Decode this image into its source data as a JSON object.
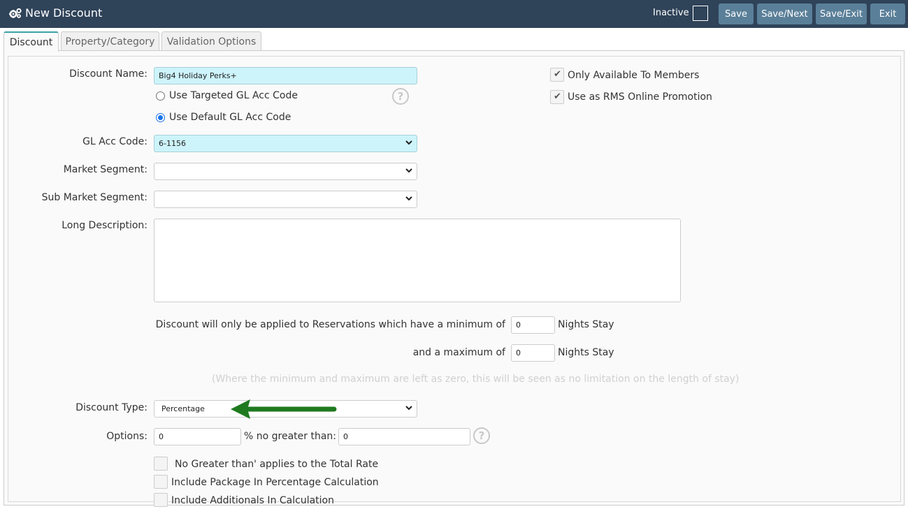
{
  "header": {
    "title": "New Discount",
    "inactive_label": "Inactive",
    "buttons": {
      "save": "Save",
      "save_next": "Save/Next",
      "save_exit": "Save/Exit",
      "exit": "Exit"
    }
  },
  "tabs": [
    {
      "label": "Discount",
      "active": true
    },
    {
      "label": "Property/Category",
      "active": false
    },
    {
      "label": "Validation Options",
      "active": false
    }
  ],
  "form": {
    "discount_name": {
      "label": "Discount Name:",
      "value": "Big4 Holiday Perks+"
    },
    "gl_radio_targeted": {
      "label": "Use Targeted GL Acc Code",
      "selected": false
    },
    "gl_radio_default": {
      "label": "Use Default GL Acc Code",
      "selected": true
    },
    "gl_acc_code": {
      "label": "GL Acc Code:",
      "value": "6-1156"
    },
    "market_segment": {
      "label": "Market Segment:",
      "value": ""
    },
    "sub_market_segment": {
      "label": "Sub Market Segment:",
      "value": ""
    },
    "long_description": {
      "label": "Long Description:",
      "value": ""
    },
    "only_members": {
      "label": "Only Available To Members",
      "checked": true
    },
    "rms_online": {
      "label": "Use as RMS Online Promotion",
      "checked": true
    },
    "min_stay": {
      "label": "Discount will only be applied to Reservations which have a minimum of",
      "value": "0",
      "suffix": "Nights Stay"
    },
    "max_stay": {
      "label": "and a maximum of",
      "value": "0",
      "suffix": "Nights Stay"
    },
    "stay_note": "(Where the minimum and maximum are left as zero, this will be seen as no limitation on the length of stay)",
    "discount_type": {
      "label": "Discount Type:",
      "value": "Percentage"
    },
    "options": {
      "label": "Options:",
      "percent_value": "0",
      "middle_text": "% no greater than: $",
      "max_value": "0"
    },
    "chk_total_rate": {
      "label": "No Greater than' applies to the Total Rate",
      "checked": false
    },
    "chk_package": {
      "label": "Include Package In Percentage Calculation",
      "checked": false
    },
    "chk_additionals": {
      "label": "Include Additionals In Calculation",
      "checked": false
    }
  },
  "icons": {
    "header": "cogs-icon",
    "help": "question-circle-icon",
    "dropdown": "chevron-down-icon",
    "annotation": "green-arrow"
  },
  "colors": {
    "header_bg": "#2f4359",
    "button_bg": "#5a7f98",
    "required_field_bg": "#cdf3fb",
    "tab_accent": "#3aa1a8",
    "arrow": "#1f7a1f"
  }
}
